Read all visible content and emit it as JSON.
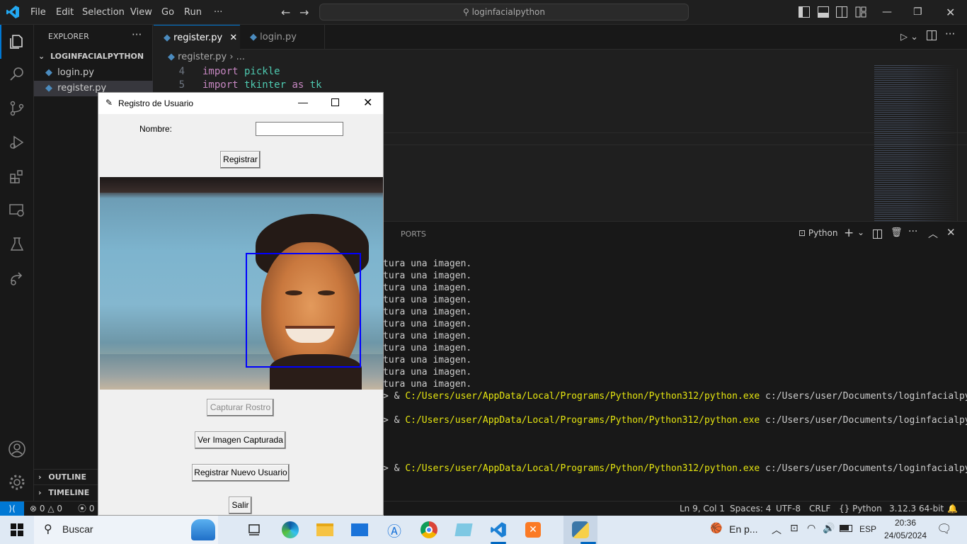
{
  "titlebar": {
    "menu": [
      "File",
      "Edit",
      "Selection",
      "View",
      "Go",
      "Run",
      "···"
    ],
    "search": "loginfacialpython"
  },
  "sidebar": {
    "header": "EXPLORER",
    "folder": "LOGINFACIALPYTHON",
    "files": [
      "login.py",
      "register.py"
    ],
    "outline": "OUTLINE",
    "timeline": "TIMELINE"
  },
  "tabs": {
    "active": "register.py",
    "inactive": "login.py"
  },
  "breadcrumb": {
    "file": "register.py",
    "more": "..."
  },
  "editor": {
    "lines": [
      {
        "num": "4",
        "kw": "import",
        "rest": " pickle"
      },
      {
        "num": "5",
        "kw": "import",
        "rest": " tkinter ",
        "kw2": "as",
        "rest2": " tk"
      }
    ]
  },
  "panel": {
    "tab": "PORTS",
    "shell": "Python",
    "output_text": "tura una imagen.",
    "output_count": 11,
    "cmd_prefix": "> & ",
    "cmd_path": "C:/Users/user/AppData/Local/Programs/Python/Python312/python.exe",
    "cmd_arg": " c:/Users/user/Documents/loginfacialpython/reg"
  },
  "status": {
    "problems": "0",
    "warnings": "0",
    "ports": "0",
    "position": "Ln 9, Col 1",
    "spaces": "Spaces: 4",
    "encoding": "UTF-8",
    "eol": "CRLF",
    "language": "Python",
    "interpreter": "3.12.3 64-bit"
  },
  "tkwindow": {
    "title": "Registro de Usuario",
    "nombre_label": "Nombre:",
    "nombre_value": "",
    "registrar": "Registrar",
    "capturar": "Capturar Rostro",
    "ver_imagen": "Ver Imagen Capturada",
    "registrar_nuevo": "Registrar Nuevo Usuario",
    "salir": "Salir"
  },
  "taskbar": {
    "search": "Buscar",
    "weather": "En p...",
    "lang": "ESP",
    "time": "20:36",
    "date": "24/05/2024"
  },
  "colors": {
    "accent": "#0078d4",
    "keyword": "#c586c0",
    "term_path": "#e5e510",
    "face_box": "#0000ff"
  }
}
